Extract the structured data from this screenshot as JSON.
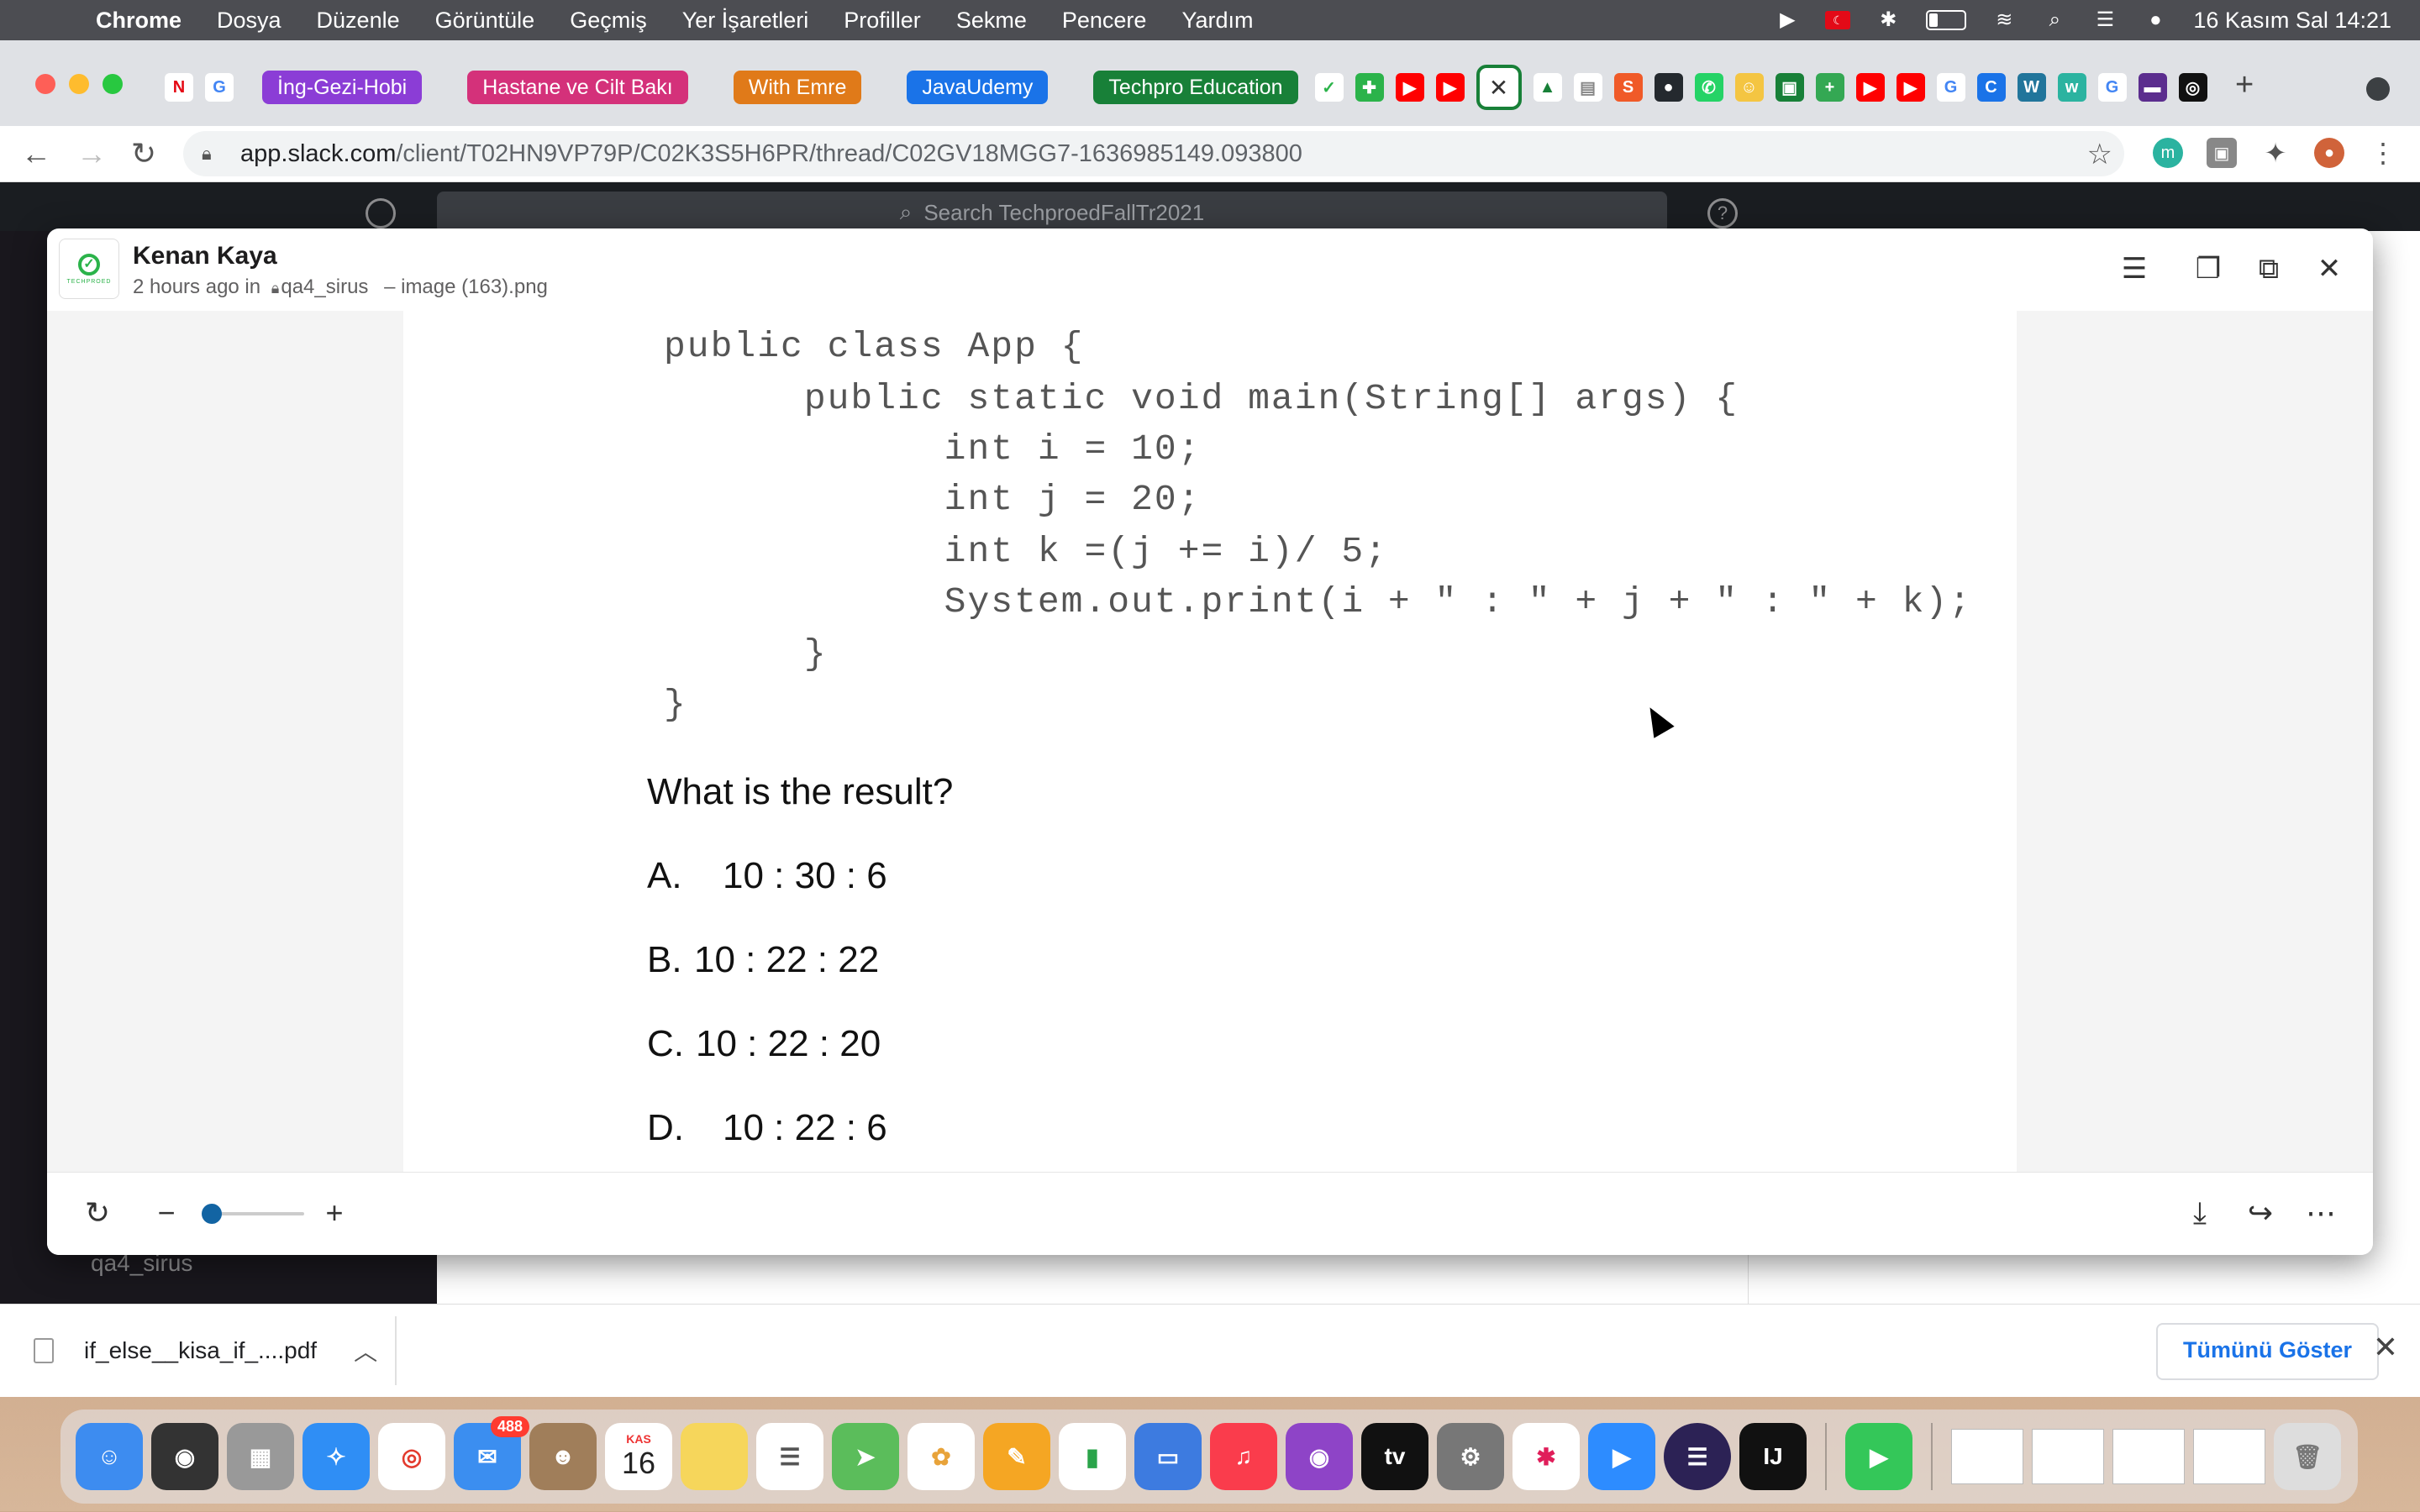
{
  "menubar": {
    "app_name": "Chrome",
    "menus": [
      "Dosya",
      "Düzenle",
      "Görüntüle",
      "Geçmiş",
      "Yer İşaretleri",
      "Profiller",
      "Sekme",
      "Pencere",
      "Yardım"
    ],
    "clock": "16 Kasım Sal  14:21"
  },
  "tabs": {
    "groups": [
      {
        "label": "İng-Gezi-Hobi",
        "color": "#8b3dd6"
      },
      {
        "label": "Hastane ve Cilt Bakı",
        "color": "#d4317a"
      },
      {
        "label": "With Emre",
        "color": "#e07a19"
      },
      {
        "label": "JavaUdemy",
        "color": "#1a73e8"
      },
      {
        "label": "Techpro Education",
        "color": "#188038"
      }
    ],
    "active_tab_glyph": "✕",
    "new_tab_glyph": "+"
  },
  "omnibox": {
    "host": "app.slack.com",
    "path": "/client/T02HN9VP79P/C02K3S5H6PR/thread/C02GV18MGG7-1636985149.093800"
  },
  "slack": {
    "search_placeholder": "Search TechproedFallTr2021",
    "sidebar_channel": "qa4_sirus"
  },
  "viewer": {
    "sender": "Kenan Kaya",
    "time": "2 hours ago in",
    "channel": "qa4_sirus",
    "filename": "– image (163).png",
    "zoom_level": 0.08
  },
  "image_content": {
    "code_lines": [
      "public class App {",
      "      public static void main(String[] args) {",
      "            int i = 10;",
      "            int j = 20;",
      "            int k =(j += i)/ 5;",
      "            System.out.print(i + \" : \" + j + \" : \" + k);",
      "      }",
      "}"
    ],
    "question": "What is the result?",
    "options": [
      {
        "letter": "A.",
        "text": "10 : 30 : 6"
      },
      {
        "letter": "B.",
        "text": "10 : 22 : 22"
      },
      {
        "letter": "C.",
        "text": "10 : 22 : 20"
      },
      {
        "letter": "D.",
        "text": "10 : 22 : 6"
      }
    ]
  },
  "downloads": {
    "file": "if_else__kisa_if_....pdf",
    "show_all": "Tümünü Göster"
  },
  "dock": {
    "calendar_month": "KAS",
    "calendar_day": "16",
    "mail_badge": "488",
    "intellij_label": "IJ"
  }
}
